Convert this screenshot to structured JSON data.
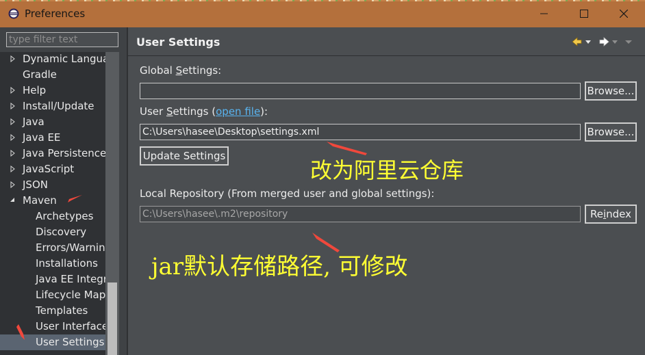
{
  "window": {
    "title": "Preferences",
    "controls": [
      "minimize",
      "maximize",
      "close"
    ]
  },
  "colors": {
    "titlebar": "#b4703c",
    "panel_bg": "#4b4e51",
    "link": "#59b4f0",
    "annotation_text": "#ffff33",
    "annotation_arrow": "#f0483c"
  },
  "filter": {
    "placeholder": "type filter text"
  },
  "tree": {
    "items": [
      {
        "label": "Dynamic Languag",
        "expandable": true
      },
      {
        "label": "Gradle",
        "expandable": false
      },
      {
        "label": "Help",
        "expandable": true
      },
      {
        "label": "Install/Update",
        "expandable": true
      },
      {
        "label": "Java",
        "expandable": true
      },
      {
        "label": "Java EE",
        "expandable": true
      },
      {
        "label": "Java Persistence",
        "expandable": true
      },
      {
        "label": "JavaScript",
        "expandable": true
      },
      {
        "label": "JSON",
        "expandable": true
      },
      {
        "label": "Maven",
        "expandable": true,
        "expanded": true
      },
      {
        "label": "Archetypes",
        "child": true
      },
      {
        "label": "Discovery",
        "child": true
      },
      {
        "label": "Errors/Warning",
        "child": true
      },
      {
        "label": "Installations",
        "child": true
      },
      {
        "label": "Java EE Integra",
        "child": true
      },
      {
        "label": "Lifecycle Mapp",
        "child": true
      },
      {
        "label": "Templates",
        "child": true
      },
      {
        "label": "User Interface",
        "child": true
      },
      {
        "label": "User Settings",
        "child": true,
        "selected": true
      }
    ]
  },
  "page": {
    "title": "User Settings",
    "nav_icons": [
      "back-arrow-icon",
      "dropdown-icon",
      "forward-arrow-icon",
      "dropdown-icon",
      "view-menu-icon"
    ],
    "global_settings": {
      "label_before": "Global ",
      "label_mnemonic": "S",
      "label_after": "ettings:",
      "value": "",
      "browse": "Browse..."
    },
    "user_settings": {
      "label_before": "User ",
      "label_mnemonic": "S",
      "label_after": "ettings (",
      "link": "open file",
      "label_close": "):",
      "value": "C:\\Users\\hasee\\Desktop\\settings.xml",
      "browse": "Browse..."
    },
    "update_settings": "Update Settings",
    "local_repository": {
      "label": "Local Repository (From merged user and global settings):",
      "value": "C:\\Users\\hasee\\.m2\\repository",
      "reindex_before": "Re",
      "reindex_mnemonic": "i",
      "reindex_after": "ndex"
    }
  },
  "annotations": {
    "settings_note": "改为阿里云仓库",
    "repo_note": "jar默认存储路径, 可修改"
  }
}
